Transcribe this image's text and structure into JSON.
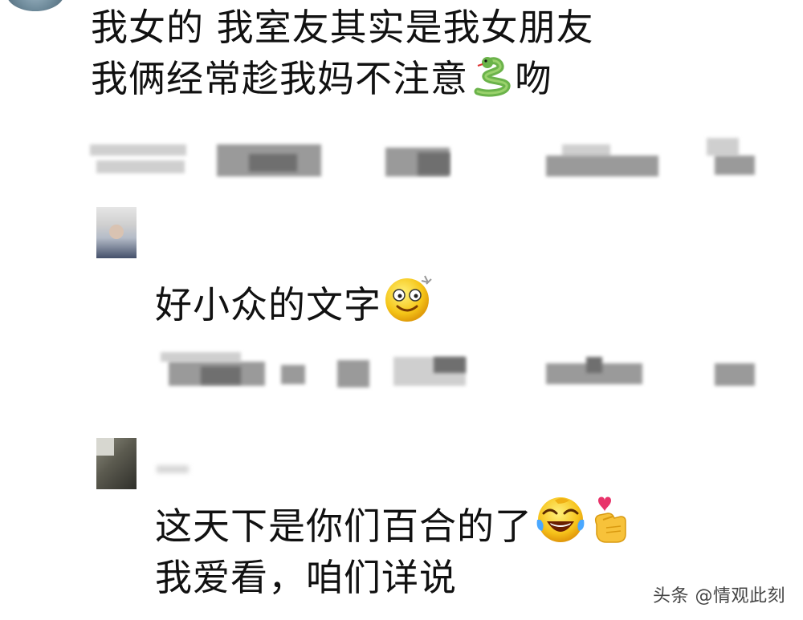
{
  "comments": [
    {
      "lines": [
        "我女的 我室友其实是我女朋友",
        "我俩经常趁我妈不注意",
        "吻"
      ],
      "emoji": "snake-emoji"
    },
    {
      "text": "好小众的文字",
      "emoji": "dizzy-smile-emoji"
    },
    {
      "lines": [
        "这天下是你们百合的了",
        "我爱看，咱们详说"
      ],
      "emoji": [
        "laughing-tears-emoji",
        "finger-heart-emoji"
      ]
    }
  ],
  "watermark": "头条 @情观此刻",
  "colors": {
    "text": "#111111",
    "meta_blur": "#9a9a9a",
    "watermark": "#444444"
  }
}
